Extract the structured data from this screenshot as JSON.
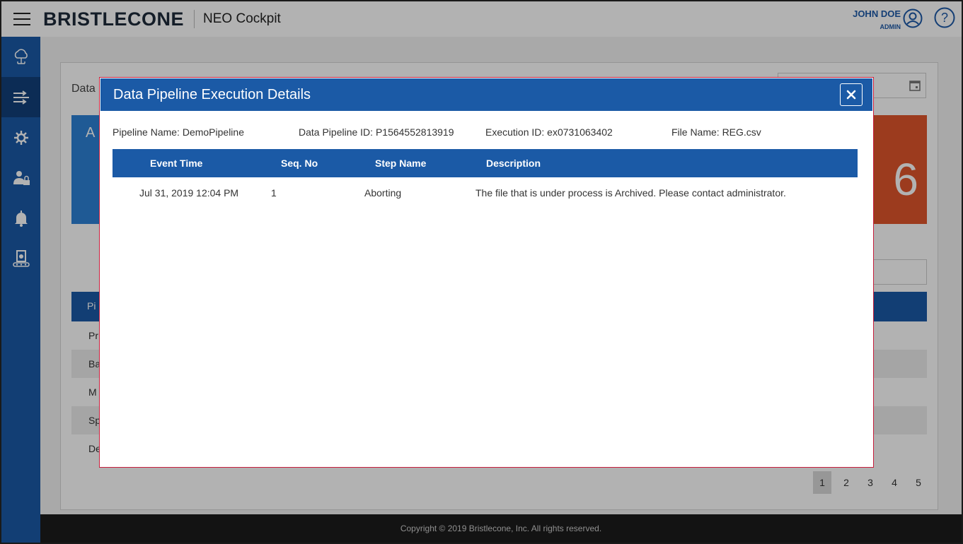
{
  "header": {
    "brand": "BRISTLECONE",
    "app_name": "NEO Cockpit",
    "user_name": "JOHN DOE",
    "user_role": "ADMIN"
  },
  "sidebar": {
    "items": [
      {
        "icon": "cloud-network-icon"
      },
      {
        "icon": "pipeline-icon",
        "active": true
      },
      {
        "icon": "settings-tools-icon"
      },
      {
        "icon": "user-lock-icon"
      },
      {
        "icon": "bell-icon"
      },
      {
        "icon": "device-conveyor-icon"
      }
    ]
  },
  "background": {
    "card_title": "Data",
    "tile_blue_text": "A",
    "tile_red_value": "6",
    "table_header": "Pi",
    "rows": [
      "Pr",
      "Ba",
      "M",
      "Sp",
      "De"
    ],
    "pagination": [
      "1",
      "2",
      "3",
      "4",
      "5"
    ],
    "current_page": "1"
  },
  "footer": {
    "copyright": "Copyright © 2019 Bristlecone, Inc. All rights reserved."
  },
  "modal": {
    "title": "Data Pipeline Execution Details",
    "meta": {
      "pipeline_name": "Pipeline Name: DemoPipeline",
      "pipeline_id": "Data Pipeline ID: P1564552813919",
      "execution_id": "Execution ID: ex0731063402",
      "file_name": "File Name: REG.csv"
    },
    "columns": [
      "Event Time",
      "Seq. No",
      "Step Name",
      "Description"
    ],
    "rows": [
      {
        "event_time": "Jul 31, 2019 12:04 PM",
        "seq_no": "1",
        "step_name": "Aborting",
        "description": "The file that is under process is Archived. Please contact administrator."
      }
    ]
  },
  "colors": {
    "primary": "#1b5aa6",
    "sidebar_active": "#12407a",
    "modal_border": "#c81e3c",
    "accent_red": "#e0552c",
    "footer_bg": "#1c1c1c"
  }
}
